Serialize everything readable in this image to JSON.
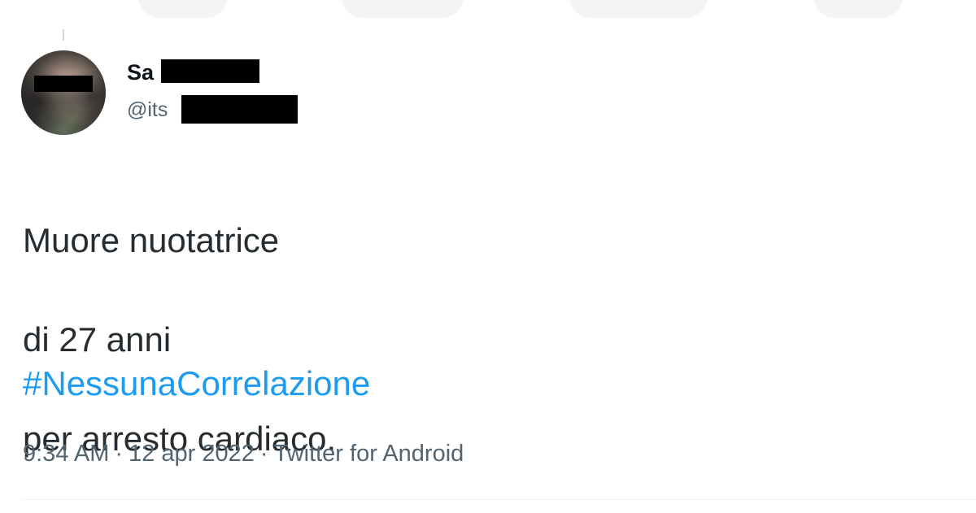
{
  "tweet": {
    "author": {
      "display_name_visible": "Sa",
      "handle_visible": "@its"
    },
    "text_lines": [
      "Muore nuotatrice",
      "di 27 anni",
      "per arresto cardiaco."
    ],
    "hashtag": "#NessunaCorrelazione",
    "meta": {
      "time": "9:34 AM",
      "separator": "·",
      "date": "12 apr 2022",
      "source": "Twitter for Android"
    }
  },
  "colors": {
    "link": "#1d9bf0",
    "secondary_text": "#536471",
    "primary_text": "#0f1419",
    "divider": "#eff3f4"
  },
  "icons": [
    "avatar-image"
  ]
}
